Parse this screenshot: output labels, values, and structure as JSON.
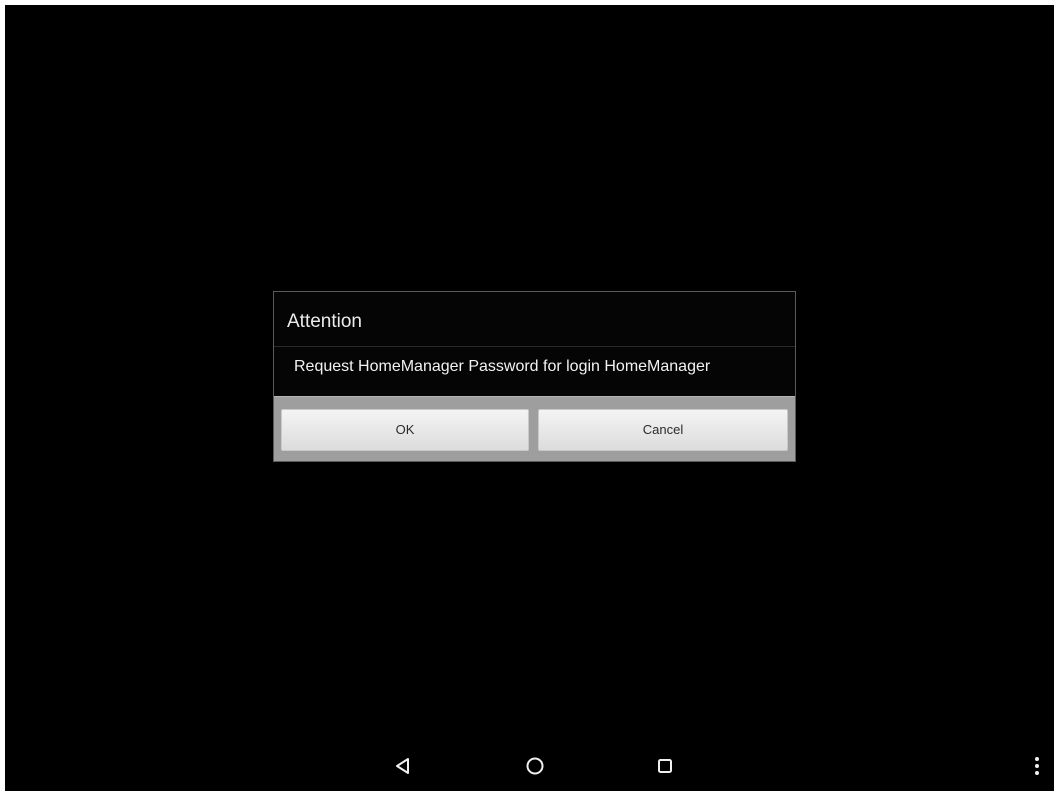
{
  "dialog": {
    "title": "Attention",
    "message": "Request HomeManager Password for login HomeManager",
    "ok_label": "OK",
    "cancel_label": "Cancel"
  },
  "nav_bar": {
    "icons": [
      "back-icon",
      "home-icon",
      "recents-icon",
      "overflow-menu-icon"
    ]
  },
  "colors": {
    "background": "#000000",
    "dialog_bg": "#050505",
    "button_bar": "#9e9e9e",
    "button_face": "#e8e8e8",
    "text_light": "#ececec"
  }
}
